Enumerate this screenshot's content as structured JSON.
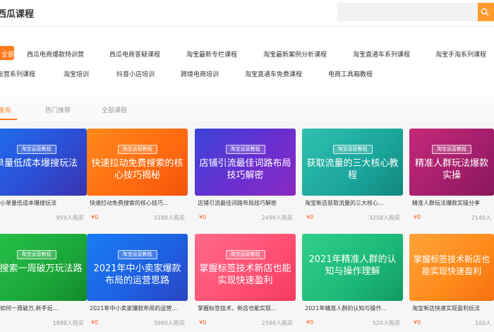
{
  "header": {
    "logo_text": "西瓜课程",
    "search": {
      "placeholder": ""
    }
  },
  "categories": {
    "active_label": "全部",
    "items": [
      "西瓜电商爆款特训营",
      "西瓜电商答疑课程",
      "淘宝最新专栏课程",
      "淘宝最新案例分析课程",
      "淘宝直通车系列课程",
      "淘宝手淘系列课程",
      "运营系列课程",
      "淘宝培训",
      "抖音小店培训",
      "跨境电商培训",
      "淘宝直通车免费课程",
      "电商工具箱教程"
    ]
  },
  "tabs": {
    "items": [
      "发布",
      "热门推荐",
      "全部课程"
    ],
    "active_index": 0
  },
  "courses": [
    {
      "badge": "淘宝运营教程",
      "thumb_title": "单量低成本爆搜玩法",
      "title": "店铺小单量低成本爆搜玩法",
      "price": "",
      "buyers": "959人购买"
    },
    {
      "badge": "淘宝运营教程",
      "thumb_title": "快速拉动免费搜索的核心技巧揭秘",
      "title": "快速拉动免费搜索的核心技巧...",
      "price": "¥0",
      "buyers": "3188人购买"
    },
    {
      "badge": "淘宝运营教程",
      "thumb_title": "店铺引流最佳词路布局技巧解密",
      "title": "店铺引流最佳词路布局技巧解密",
      "price": "¥0",
      "buyers": "2499人购买"
    },
    {
      "badge": "淘宝运营教程",
      "thumb_title": "获取流量的三大核心教程",
      "title": "淘宝新店获取流量的三大核心...",
      "price": "¥0",
      "buyers": "3258人购买"
    },
    {
      "badge": "淘宝运营教程",
      "thumb_title": "精准人群玩法爆款实操",
      "title": "精准人群玩法爆款实操分享",
      "price": "¥0",
      "buyers": "2140人"
    },
    {
      "badge": "淘宝运营教程",
      "thumb_title": "铺搜索一周破万玩法路",
      "title": "卖家如何一周破万,新手玩...",
      "price": "",
      "buyers": "1888人购买"
    },
    {
      "badge": "淘宝运营教程",
      "thumb_title": "2021年中小卖家爆款布局的运营思路",
      "title": "2021年中小卖家爆款布局的运营...",
      "price": "¥0",
      "buyers": "3960人购买"
    },
    {
      "badge": "淘宝运营教程",
      "thumb_title": "掌握标签技术新店也能实现快速盈利",
      "title": "掌握标签技术，新店也能实现...",
      "price": "¥0",
      "buyers": "2598人购买"
    },
    {
      "badge": "",
      "thumb_title": "2021年精准人群的认知与操作理解",
      "title": "2021年精准人群的认知与操作...",
      "price": "¥0",
      "buyers": "520人购买"
    },
    {
      "badge": "",
      "thumb_title": "掌握标签技术新店也能实现快速盈利",
      "title": "淘宝新店快速实现盈利玩法",
      "price": "¥0",
      "buyers": "100人"
    }
  ]
}
